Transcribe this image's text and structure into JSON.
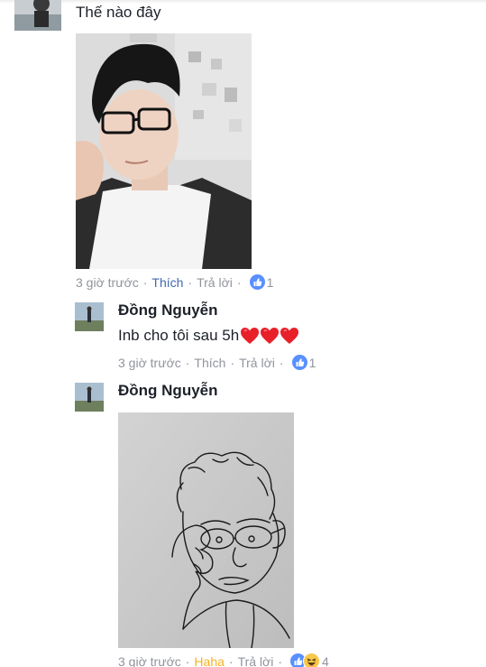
{
  "thread": {
    "top_comment": {
      "text": "Thế nào đây",
      "time": "3 giờ trước",
      "like_label": "Thích",
      "reply_label": "Trả lời",
      "reaction_count": "1",
      "reaction_icons": [
        "like-icon"
      ]
    },
    "replies": [
      {
        "author": "Đồng Nguyễn",
        "text": "Inb cho tôi sau 5h",
        "emoji": [
          "heart-icon",
          "heart-icon",
          "heart-icon"
        ],
        "time": "3 giờ trước",
        "like_label": "Thích",
        "reply_label": "Trả lời",
        "reaction_count": "1",
        "reaction_icons": [
          "like-icon"
        ]
      },
      {
        "author": "Đồng Nguyễn",
        "time": "3 giờ trước",
        "like_label": "Haha",
        "reply_label": "Trả lời",
        "reaction_count": "4",
        "reaction_icons": [
          "like-icon",
          "haha-icon"
        ]
      }
    ]
  },
  "colors": {
    "text": "#1d2129",
    "meta": "#90949c",
    "liked": "#4267b2",
    "haha": "#f7b125",
    "heart": "#e8202a",
    "like_badge": "#5890ff"
  },
  "separator": "·"
}
